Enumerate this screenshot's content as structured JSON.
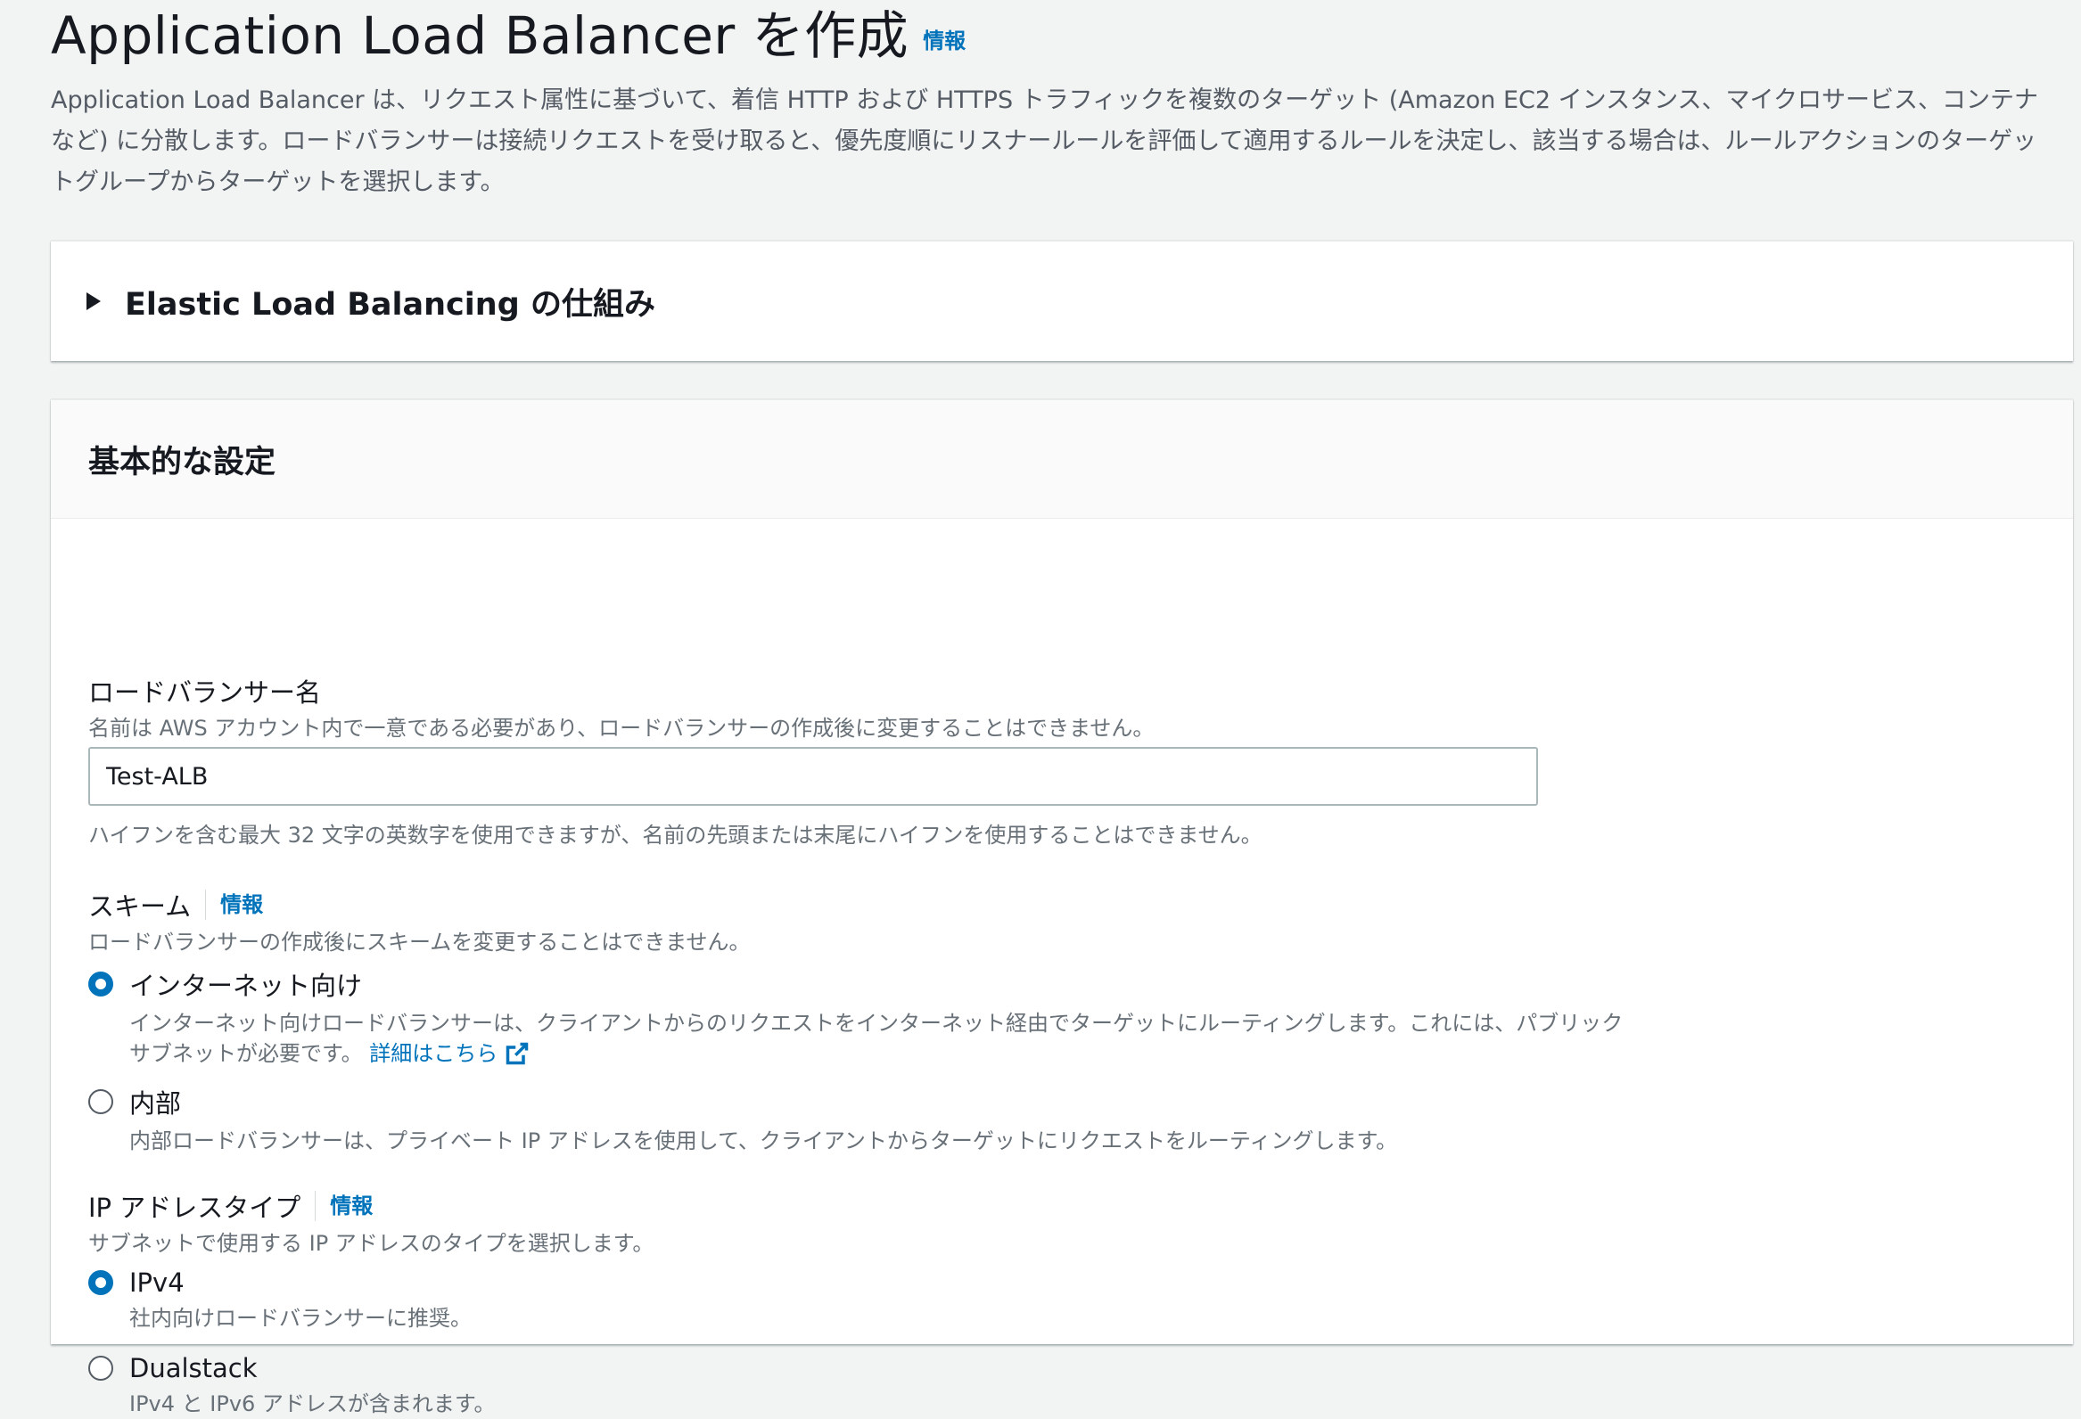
{
  "header": {
    "title": "Application Load Balancer を作成",
    "info": "情報",
    "description": "Application Load Balancer は、リクエスト属性に基づいて、着信 HTTP および HTTPS トラフィックを複数のターゲット (Amazon EC2 インスタンス、マイクロサービス、コンテナなど) に分散します。ロードバランサーは接続リクエストを受け取ると、優先度順にリスナールールを評価して適用するルールを決定し、該当する場合は、ルールアクションのターゲットグループからターゲットを選択します。"
  },
  "how_it_works": {
    "title": "Elastic Load Balancing の仕組み",
    "expanded": false
  },
  "basic_settings": {
    "title": "基本的な設定",
    "name": {
      "label": "ロードバランサー名",
      "description": "名前は AWS アカウント内で一意である必要があり、ロードバランサーの作成後に変更することはできません。",
      "value": "Test-ALB",
      "constraint": "ハイフンを含む最大 32 文字の英数字を使用できますが、名前の先頭または末尾にハイフンを使用することはできません。"
    },
    "scheme": {
      "label": "スキーム",
      "info": "情報",
      "description": "ロードバランサーの作成後にスキームを変更することはできません。",
      "options": [
        {
          "label": "インターネット向け",
          "description": "インターネット向けロードバランサーは、クライアントからのリクエストをインターネット経由でターゲットにルーティングします。これには、パブリックサブネットが必要です。",
          "link": "詳細はこちら",
          "selected": true
        },
        {
          "label": "内部",
          "description": "内部ロードバランサーは、プライベート IP アドレスを使用して、クライアントからターゲットにリクエストをルーティングします。",
          "selected": false
        }
      ]
    },
    "ip_address_type": {
      "label": "IP アドレスタイプ",
      "info": "情報",
      "description": "サブネットで使用する IP アドレスのタイプを選択します。",
      "options": [
        {
          "label": "IPv4",
          "description": "社内向けロードバランサーに推奨。",
          "selected": true
        },
        {
          "label": "Dualstack",
          "description": "IPv4 と IPv6 アドレスが含まれます。",
          "selected": false
        }
      ]
    }
  },
  "colors": {
    "link": "#0073bb",
    "page_bg": "#f2f3f3",
    "text": "#16191f",
    "muted": "#687078"
  }
}
